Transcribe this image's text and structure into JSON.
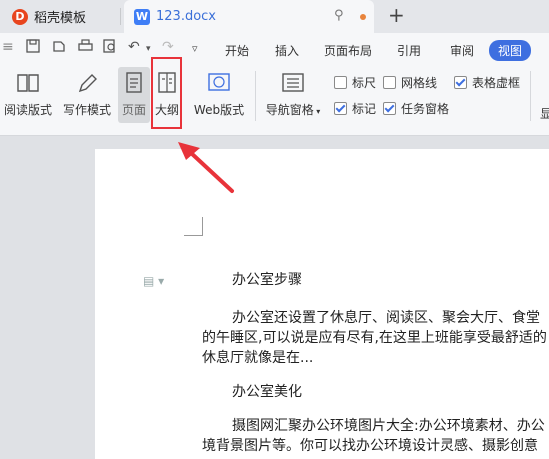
{
  "tabs": {
    "tab1": {
      "label": "稻壳模板",
      "logo": "D"
    },
    "tab2": {
      "label": "123.docx",
      "logo": "W"
    },
    "new_tab": "+"
  },
  "toolbar": {
    "menus": [
      "开始",
      "插入",
      "页面布局",
      "引用",
      "审阅",
      "视图"
    ],
    "active_menu": "视图"
  },
  "ribbon": {
    "read_mode": "阅读版式",
    "write_mode": "写作模式",
    "page": "页面",
    "outline": "大纲",
    "web": "Web版式",
    "nav_pane": "导航窗格",
    "ruler": "标尺",
    "gridlines": "网格线",
    "table_gridlines": "表格虚框",
    "marks": "标记",
    "task_pane": "任务窗格",
    "truncated": "显"
  },
  "document": {
    "heading1": "办公室步骤",
    "para1_line1": "办公室还设置了休息厅、阅读区、聚会大厅、食堂",
    "para1_line2": "的午睡区,可以说是应有尽有,在这里上班能享受最舒适的",
    "para1_line3": "休息厅就像是在...",
    "heading2": "办公室美化",
    "para2_line1": "摄图网汇聚办公环境图片大全:办公环境素材、办公",
    "para2_line2": "境背景图片等。你可以找办公环境设计灵感、摄影创意"
  },
  "colors": {
    "accent": "#3e6fe0",
    "highlight": "#e8333a",
    "arrow": "#e8333a"
  }
}
